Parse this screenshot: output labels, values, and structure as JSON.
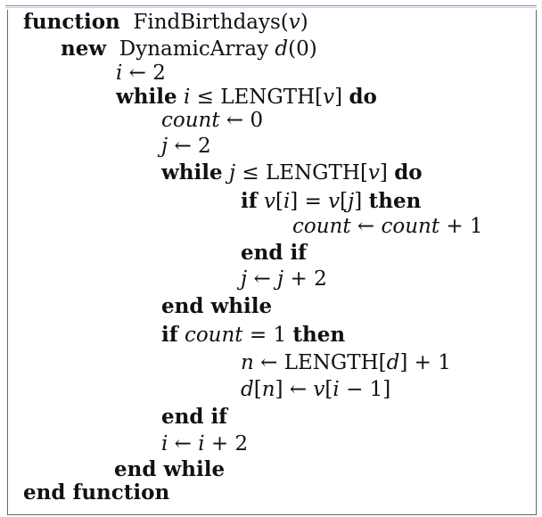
{
  "algorithm": {
    "lines": [
      {
        "kw1": "function",
        "t1": "FindBirthdays(",
        "i1": "v",
        "t2": ")"
      },
      {
        "kw1": "new",
        "t1": "DynamicArray ",
        "i1": "d",
        "t2": "(0)"
      },
      {
        "i1": "i",
        "t1": " ← 2"
      },
      {
        "kw1": "while",
        "i1": "i",
        "t1": " ≤ LENGTH[",
        "i2": "v",
        "t2": "] ",
        "kw2": "do"
      },
      {
        "i1": "count",
        "t1": " ← 0"
      },
      {
        "i1": "j",
        "t1": " ← 2"
      },
      {
        "kw1": "while",
        "i1": "j",
        "t1": " ≤ LENGTH[",
        "i2": "v",
        "t2": "] ",
        "kw2": "do"
      },
      {
        "kw1": "if",
        "i1": "v",
        "t1": "[",
        "i2": "i",
        "t2": "] = ",
        "i3": "v",
        "t3": "[",
        "i4": "j",
        "t4": "] ",
        "kw2": "then"
      },
      {
        "i1": "count",
        "t1": " ← ",
        "i2": "count",
        "t2": " + 1"
      },
      {
        "kw1": "end if"
      },
      {
        "i1": "j",
        "t1": " ← ",
        "i2": "j",
        "t2": " + 2"
      },
      {
        "kw1": "end while"
      },
      {
        "kw1": "if",
        "i1": "count",
        "t1": " = 1 ",
        "kw2": "then"
      },
      {
        "i1": "n",
        "t1": " ← LENGTH[",
        "i2": "d",
        "t2": "] + 1"
      },
      {
        "i1": "d",
        "t1": "[",
        "i2": "n",
        "t2": "] ← ",
        "i3": "v",
        "t3": "[",
        "i4": "i",
        "t4": " − 1]"
      },
      {
        "kw1": "end if"
      },
      {
        "i1": "i",
        "t1": " ← ",
        "i2": "i",
        "t2": " + 2"
      },
      {
        "kw1": "end while"
      },
      {
        "kw1": "end function"
      }
    ]
  }
}
